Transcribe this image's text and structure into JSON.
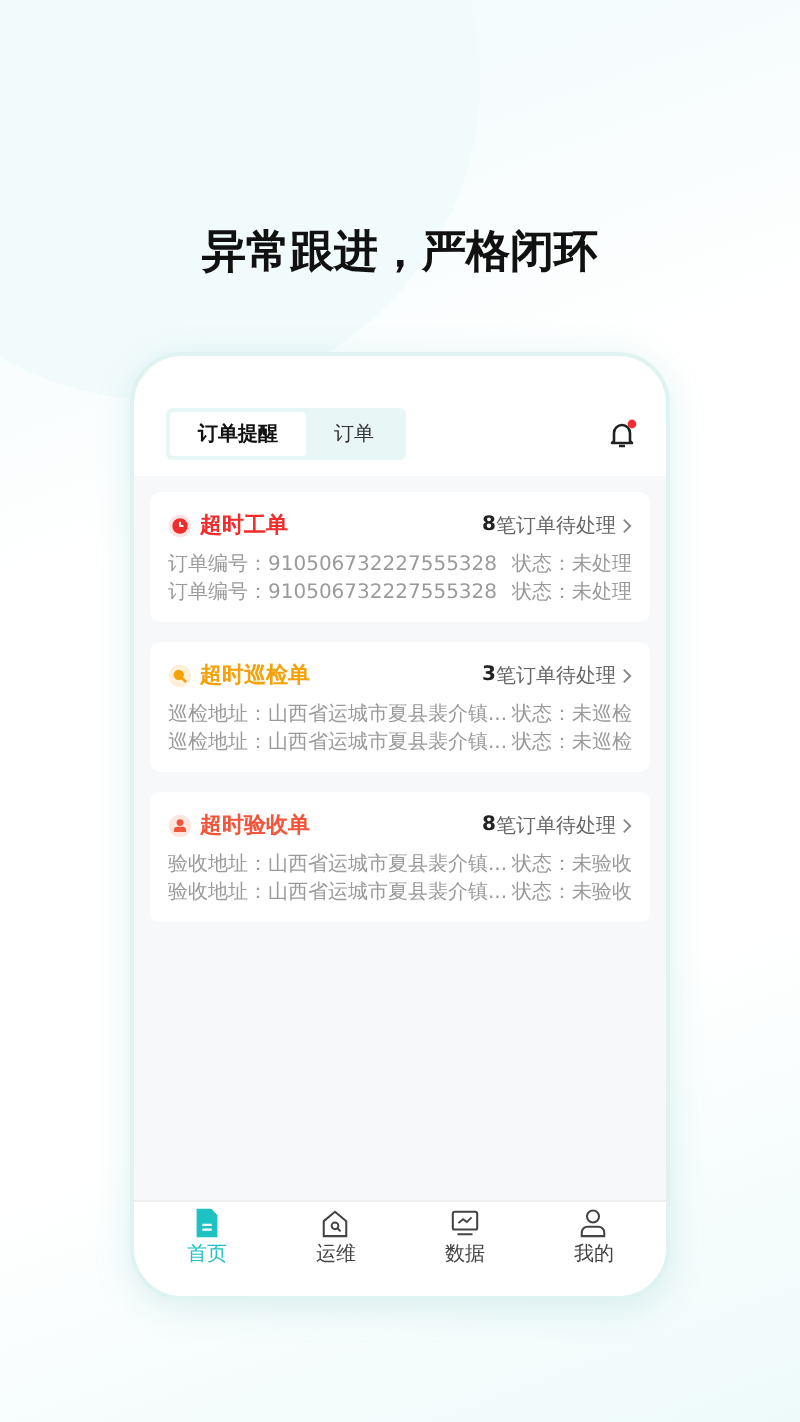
{
  "heading": "异常跟进，严格闭环",
  "tabs": [
    {
      "label": "订单提醒",
      "selected": true
    },
    {
      "label": "订单",
      "selected": false
    }
  ],
  "notification": {
    "unread": true
  },
  "cards": [
    {
      "kind": "work_order",
      "title": "超时工单",
      "color": "#f02c2c",
      "count": "8",
      "count_suffix": "笔订单待处理",
      "rows": [
        {
          "info": "订单编号：910506732227555328",
          "status": "状态：未处理"
        },
        {
          "info": "订单编号：910506732227555328",
          "status": "状态：未处理"
        }
      ]
    },
    {
      "kind": "inspection",
      "title": "超时巡检单",
      "color": "#f5a10a",
      "count": "3",
      "count_suffix": "笔订单待处理",
      "rows": [
        {
          "info": "巡检地址：山西省运城市夏县裴介镇...",
          "status": "状态：未巡检"
        },
        {
          "info": "巡检地址：山西省运城市夏县裴介镇...",
          "status": "状态：未巡检"
        }
      ]
    },
    {
      "kind": "acceptance",
      "title": "超时验收单",
      "color": "#f2553a",
      "count": "8",
      "count_suffix": "笔订单待处理",
      "rows": [
        {
          "info": "验收地址：山西省运城市夏县裴介镇...",
          "status": "状态：未验收"
        },
        {
          "info": "验收地址：山西省运城市夏县裴介镇...",
          "status": "状态：未验收"
        }
      ]
    }
  ],
  "nav": [
    {
      "kind": "home",
      "label": "首页",
      "selected": true
    },
    {
      "kind": "maintenance",
      "label": "运维",
      "selected": false
    },
    {
      "kind": "data",
      "label": "数据",
      "selected": false
    },
    {
      "kind": "profile",
      "label": "我的",
      "selected": false
    }
  ]
}
